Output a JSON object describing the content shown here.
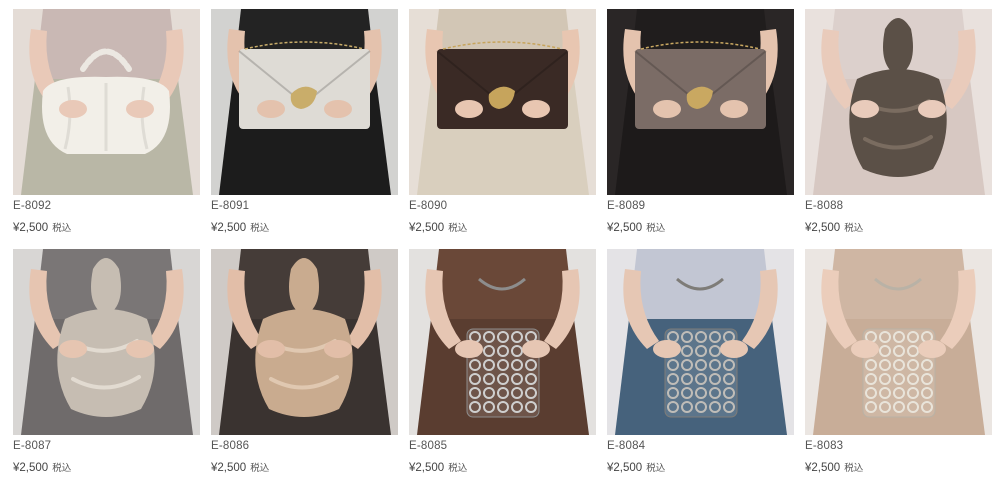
{
  "products": [
    {
      "code": "E-8092",
      "price": "¥2,500",
      "tax": "税込",
      "colors": {
        "bg": "#e4dcd6",
        "dress": "#b9b7a6",
        "top": "#c9b8b4",
        "skin": "#e9c9b8",
        "bag": "#f2efe8",
        "accent": "#ece8e2"
      },
      "style": "pouch"
    },
    {
      "code": "E-8091",
      "price": "¥2,500",
      "tax": "税込",
      "colors": {
        "bg": "#d2d2d0",
        "dress": "#1c1c1c",
        "top": "#232323",
        "skin": "#e4c2ad",
        "bag": "#dedbd5",
        "accent": "#c9ad6a"
      },
      "style": "clutch"
    },
    {
      "code": "E-8090",
      "price": "¥2,500",
      "tax": "税込",
      "colors": {
        "bg": "#e6ded6",
        "dress": "#d9cfbe",
        "top": "#d2c6b5",
        "skin": "#e8c6b1",
        "bag": "#3a2a25",
        "accent": "#c6a45c"
      },
      "style": "clutch"
    },
    {
      "code": "E-8089",
      "price": "¥2,500",
      "tax": "税込",
      "colors": {
        "bg": "#2a2626",
        "dress": "#1d1a1a",
        "top": "#201d1d",
        "skin": "#e4c3ae",
        "bag": "#7b6c66",
        "accent": "#c9a861"
      },
      "style": "clutch"
    },
    {
      "code": "E-8088",
      "price": "¥2,500",
      "tax": "税込",
      "colors": {
        "bg": "#e9e1dd",
        "dress": "#d7c8c2",
        "top": "#dcd0cc",
        "skin": "#e9cbbb",
        "bag": "#5b5047",
        "accent": "#7a6c60"
      },
      "style": "knot"
    },
    {
      "code": "E-8087",
      "price": "¥2,500",
      "tax": "税込",
      "colors": {
        "bg": "#d8d6d4",
        "dress": "#6f6b6b",
        "top": "#7a7676",
        "skin": "#e6c5b1",
        "bag": "#c6bdb2",
        "accent": "#e2dbd1"
      },
      "style": "knot"
    },
    {
      "code": "E-8086",
      "price": "¥2,500",
      "tax": "税込",
      "colors": {
        "bg": "#cfcac6",
        "dress": "#3a3330",
        "top": "#453c38",
        "skin": "#e2bea8",
        "bag": "#c9ab8f",
        "accent": "#e0c8b1"
      },
      "style": "knot"
    },
    {
      "code": "E-8085",
      "price": "¥2,500",
      "tax": "税込",
      "colors": {
        "bg": "#e3e1df",
        "dress": "#5a3d30",
        "top": "#6a4838",
        "skin": "#e6c6b3",
        "bag": "#cfcfcf",
        "accent": "#8d8d8d"
      },
      "style": "beaded"
    },
    {
      "code": "E-8084",
      "price": "¥2,500",
      "tax": "税込",
      "colors": {
        "bg": "#e4e3e6",
        "dress": "#46627c",
        "top": "#c2c6d3",
        "skin": "#e6c7b4",
        "bag": "#c0bdb8",
        "accent": "#7e7c78"
      },
      "style": "beaded"
    },
    {
      "code": "E-8083",
      "price": "¥2,500",
      "tax": "税込",
      "colors": {
        "bg": "#ebe6e2",
        "dress": "#c8ad98",
        "top": "#cfb6a3",
        "skin": "#ebcdbb",
        "bag": "#e9e4da",
        "accent": "#b9b2a6"
      },
      "style": "beaded"
    }
  ]
}
